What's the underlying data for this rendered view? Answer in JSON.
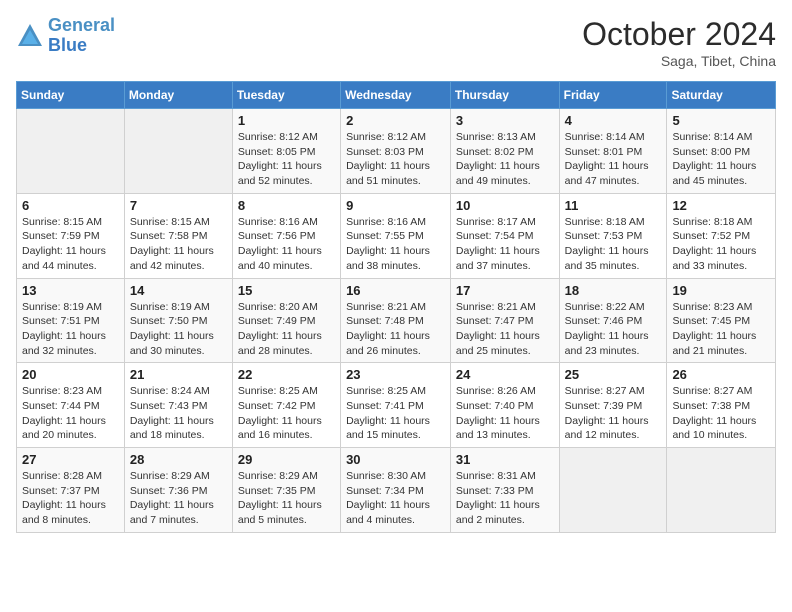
{
  "logo": {
    "line1": "General",
    "line2": "Blue"
  },
  "title": "October 2024",
  "subtitle": "Saga, Tibet, China",
  "days_header": [
    "Sunday",
    "Monday",
    "Tuesday",
    "Wednesday",
    "Thursday",
    "Friday",
    "Saturday"
  ],
  "weeks": [
    [
      {
        "day": "",
        "info": ""
      },
      {
        "day": "",
        "info": ""
      },
      {
        "day": "1",
        "info": "Sunrise: 8:12 AM\nSunset: 8:05 PM\nDaylight: 11 hours and 52 minutes."
      },
      {
        "day": "2",
        "info": "Sunrise: 8:12 AM\nSunset: 8:03 PM\nDaylight: 11 hours and 51 minutes."
      },
      {
        "day": "3",
        "info": "Sunrise: 8:13 AM\nSunset: 8:02 PM\nDaylight: 11 hours and 49 minutes."
      },
      {
        "day": "4",
        "info": "Sunrise: 8:14 AM\nSunset: 8:01 PM\nDaylight: 11 hours and 47 minutes."
      },
      {
        "day": "5",
        "info": "Sunrise: 8:14 AM\nSunset: 8:00 PM\nDaylight: 11 hours and 45 minutes."
      }
    ],
    [
      {
        "day": "6",
        "info": "Sunrise: 8:15 AM\nSunset: 7:59 PM\nDaylight: 11 hours and 44 minutes."
      },
      {
        "day": "7",
        "info": "Sunrise: 8:15 AM\nSunset: 7:58 PM\nDaylight: 11 hours and 42 minutes."
      },
      {
        "day": "8",
        "info": "Sunrise: 8:16 AM\nSunset: 7:56 PM\nDaylight: 11 hours and 40 minutes."
      },
      {
        "day": "9",
        "info": "Sunrise: 8:16 AM\nSunset: 7:55 PM\nDaylight: 11 hours and 38 minutes."
      },
      {
        "day": "10",
        "info": "Sunrise: 8:17 AM\nSunset: 7:54 PM\nDaylight: 11 hours and 37 minutes."
      },
      {
        "day": "11",
        "info": "Sunrise: 8:18 AM\nSunset: 7:53 PM\nDaylight: 11 hours and 35 minutes."
      },
      {
        "day": "12",
        "info": "Sunrise: 8:18 AM\nSunset: 7:52 PM\nDaylight: 11 hours and 33 minutes."
      }
    ],
    [
      {
        "day": "13",
        "info": "Sunrise: 8:19 AM\nSunset: 7:51 PM\nDaylight: 11 hours and 32 minutes."
      },
      {
        "day": "14",
        "info": "Sunrise: 8:19 AM\nSunset: 7:50 PM\nDaylight: 11 hours and 30 minutes."
      },
      {
        "day": "15",
        "info": "Sunrise: 8:20 AM\nSunset: 7:49 PM\nDaylight: 11 hours and 28 minutes."
      },
      {
        "day": "16",
        "info": "Sunrise: 8:21 AM\nSunset: 7:48 PM\nDaylight: 11 hours and 26 minutes."
      },
      {
        "day": "17",
        "info": "Sunrise: 8:21 AM\nSunset: 7:47 PM\nDaylight: 11 hours and 25 minutes."
      },
      {
        "day": "18",
        "info": "Sunrise: 8:22 AM\nSunset: 7:46 PM\nDaylight: 11 hours and 23 minutes."
      },
      {
        "day": "19",
        "info": "Sunrise: 8:23 AM\nSunset: 7:45 PM\nDaylight: 11 hours and 21 minutes."
      }
    ],
    [
      {
        "day": "20",
        "info": "Sunrise: 8:23 AM\nSunset: 7:44 PM\nDaylight: 11 hours and 20 minutes."
      },
      {
        "day": "21",
        "info": "Sunrise: 8:24 AM\nSunset: 7:43 PM\nDaylight: 11 hours and 18 minutes."
      },
      {
        "day": "22",
        "info": "Sunrise: 8:25 AM\nSunset: 7:42 PM\nDaylight: 11 hours and 16 minutes."
      },
      {
        "day": "23",
        "info": "Sunrise: 8:25 AM\nSunset: 7:41 PM\nDaylight: 11 hours and 15 minutes."
      },
      {
        "day": "24",
        "info": "Sunrise: 8:26 AM\nSunset: 7:40 PM\nDaylight: 11 hours and 13 minutes."
      },
      {
        "day": "25",
        "info": "Sunrise: 8:27 AM\nSunset: 7:39 PM\nDaylight: 11 hours and 12 minutes."
      },
      {
        "day": "26",
        "info": "Sunrise: 8:27 AM\nSunset: 7:38 PM\nDaylight: 11 hours and 10 minutes."
      }
    ],
    [
      {
        "day": "27",
        "info": "Sunrise: 8:28 AM\nSunset: 7:37 PM\nDaylight: 11 hours and 8 minutes."
      },
      {
        "day": "28",
        "info": "Sunrise: 8:29 AM\nSunset: 7:36 PM\nDaylight: 11 hours and 7 minutes."
      },
      {
        "day": "29",
        "info": "Sunrise: 8:29 AM\nSunset: 7:35 PM\nDaylight: 11 hours and 5 minutes."
      },
      {
        "day": "30",
        "info": "Sunrise: 8:30 AM\nSunset: 7:34 PM\nDaylight: 11 hours and 4 minutes."
      },
      {
        "day": "31",
        "info": "Sunrise: 8:31 AM\nSunset: 7:33 PM\nDaylight: 11 hours and 2 minutes."
      },
      {
        "day": "",
        "info": ""
      },
      {
        "day": "",
        "info": ""
      }
    ]
  ]
}
